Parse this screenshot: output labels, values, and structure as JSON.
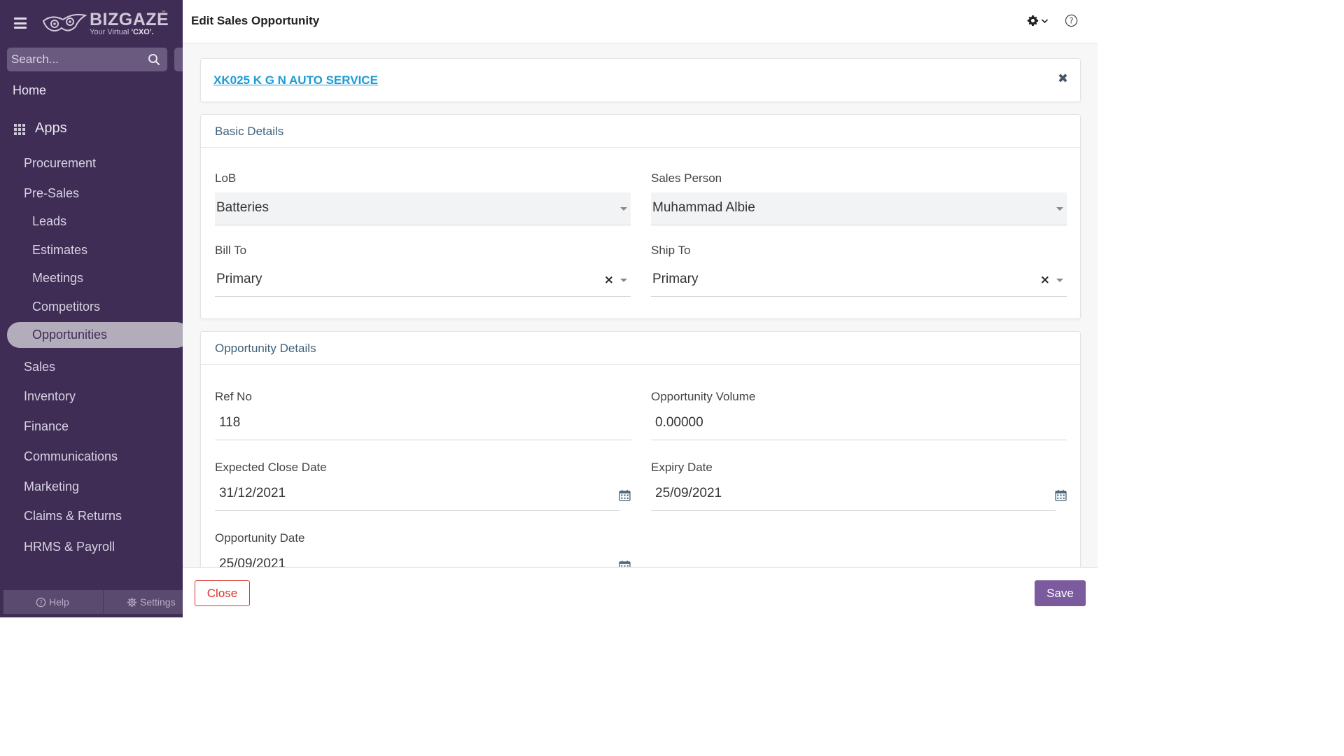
{
  "sidebar": {
    "logo": {
      "brand": "BIZGAZE",
      "tm": "™",
      "tagline_prefix": "Your Virtual ",
      "tagline_bold": "'CXO'."
    },
    "search": {
      "placeholder": "Search..."
    },
    "home_label": "Home",
    "apps_label": "Apps",
    "items": [
      {
        "label": "Procurement",
        "level": 1
      },
      {
        "label": "Pre-Sales",
        "level": 1
      },
      {
        "label": "Leads",
        "level": 2
      },
      {
        "label": "Estimates",
        "level": 2
      },
      {
        "label": "Meetings",
        "level": 2
      },
      {
        "label": "Competitors",
        "level": 2
      },
      {
        "label": "Opportunities",
        "level": 2,
        "active": true
      },
      {
        "label": "Sales",
        "level": 1
      },
      {
        "label": "Inventory",
        "level": 1
      },
      {
        "label": "Finance",
        "level": 1
      },
      {
        "label": "Communications",
        "level": 1
      },
      {
        "label": "Marketing",
        "level": 1
      },
      {
        "label": "Claims & Returns",
        "level": 1
      },
      {
        "label": "HRMS & Payroll",
        "level": 1
      }
    ],
    "bottom": {
      "help_label": "Help",
      "settings_label": "Settings"
    }
  },
  "header": {
    "title": "Edit Sales Opportunity",
    "icons": [
      "gear-icon",
      "chevron-down-icon",
      "help-circle-icon"
    ]
  },
  "account": {
    "name": "XK025 K G N AUTO SERVICE",
    "close_symbol": "✖"
  },
  "basic_details": {
    "title": "Basic Details",
    "lob": {
      "label": "LoB",
      "value": "Batteries"
    },
    "sales_person": {
      "label": "Sales Person",
      "value": "Muhammad Albie"
    },
    "bill_to": {
      "label": "Bill To",
      "value": "Primary"
    },
    "ship_to": {
      "label": "Ship To",
      "value": "Primary"
    },
    "clear_symbol": "×"
  },
  "opportunity_details": {
    "title": "Opportunity Details",
    "ref_no": {
      "label": "Ref No",
      "value": "118"
    },
    "volume": {
      "label": "Opportunity Volume",
      "value": "0.00000"
    },
    "expected_close": {
      "label": "Expected Close Date",
      "value": "31/12/2021"
    },
    "expiry": {
      "label": "Expiry Date",
      "value": "25/09/2021"
    },
    "opportunity_date": {
      "label": "Opportunity Date",
      "value": "25/09/2021"
    }
  },
  "footer": {
    "close_label": "Close",
    "save_label": "Save"
  },
  "colors": {
    "sidebar_bg": "#3f2d55",
    "active_item_bg": "#b2acbb",
    "link": "#1c9bd6",
    "close_button": "#d9342b",
    "save_button": "#7c5a9e",
    "section_title": "#3f6079"
  }
}
